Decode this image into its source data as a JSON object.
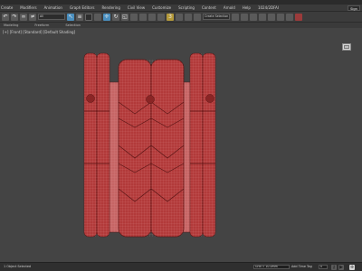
{
  "menu": {
    "items": [
      "Create",
      "Modifiers",
      "Animation",
      "Graph Editors",
      "Rendering",
      "Civil View",
      "Customize",
      "Scripting",
      "Content",
      "Arnold",
      "Help",
      "1024/2DFAI"
    ],
    "sign_in": "Sign In"
  },
  "toolbar": {
    "selection_filter": "All",
    "named_selection": "Create Selection Set"
  },
  "ribbon": {
    "tabs": [
      "Modeling",
      "Freeform",
      "Selection"
    ]
  },
  "viewport": {
    "label": "[+] [Front] [Standard] [Default Shading]",
    "model_colors": {
      "fill": "#b23a3a",
      "light": "#c66565",
      "wire": "#e9a6a6",
      "edge": "#5a1515"
    }
  },
  "status": {
    "selection": "1 Object Selected",
    "grid": "Grid = 10.0mm",
    "add_time_tag": "Add Time Tag",
    "frame": "0"
  },
  "icons": [
    "undo-icon",
    "redo-icon",
    "link-icon",
    "unlink-icon",
    "bind-icon",
    "select-icon",
    "move-icon",
    "rotate-icon",
    "scale-icon",
    "snap-icon",
    "mirror-icon",
    "align-icon",
    "render-icon",
    "viewcube-icon",
    "play-icon",
    "key-icon"
  ]
}
